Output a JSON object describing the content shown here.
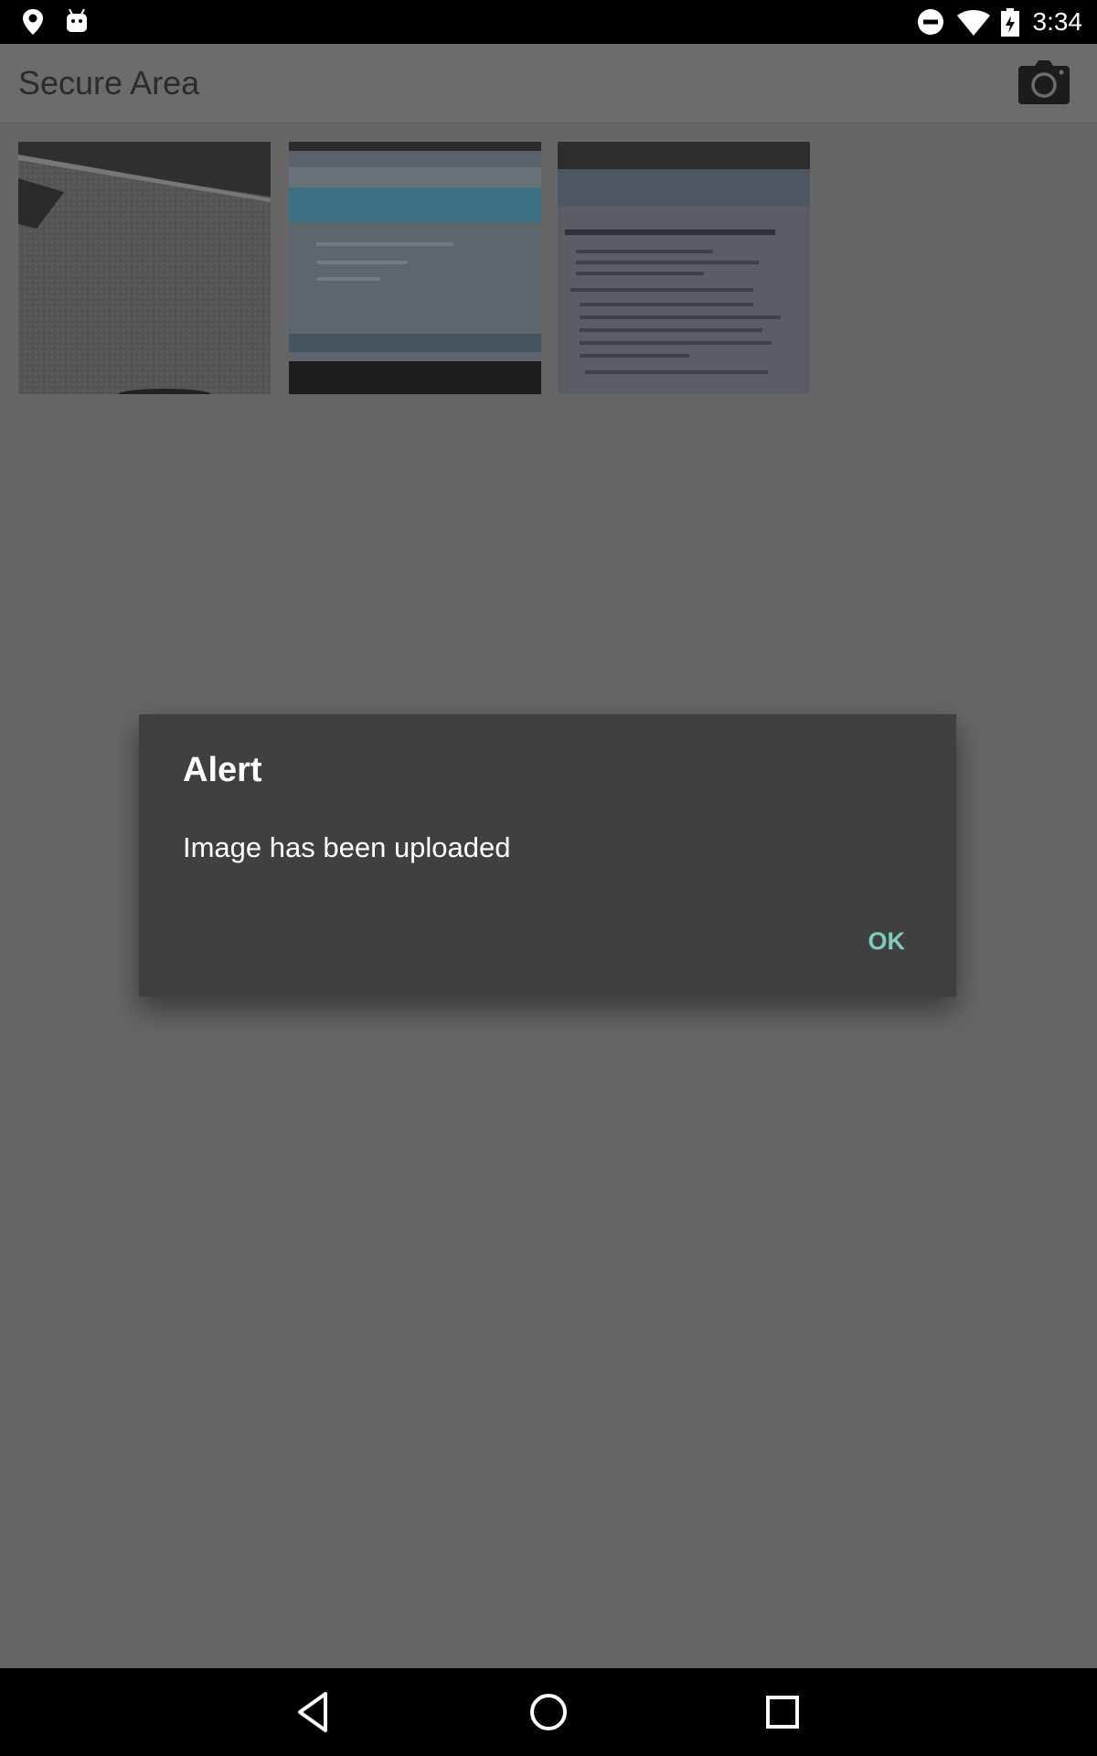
{
  "status_bar": {
    "time": "3:34",
    "icons": [
      "location-pin-icon",
      "android-debug-icon",
      "do-not-disturb-icon",
      "wifi-icon",
      "battery-charging-icon"
    ]
  },
  "app_bar": {
    "title": "Secure Area",
    "action_icon": "camera-icon"
  },
  "gallery": {
    "thumbnails": [
      {
        "description_icon": "photo-thumbnail"
      },
      {
        "description_icon": "photo-thumbnail"
      },
      {
        "description_icon": "photo-thumbnail"
      }
    ]
  },
  "dialog": {
    "title": "Alert",
    "message": "Image has been uploaded",
    "ok_label": "OK",
    "accent_color": "#7fcbbd"
  },
  "nav_bar": {
    "icons": [
      "back-icon",
      "home-icon",
      "recents-icon"
    ]
  }
}
